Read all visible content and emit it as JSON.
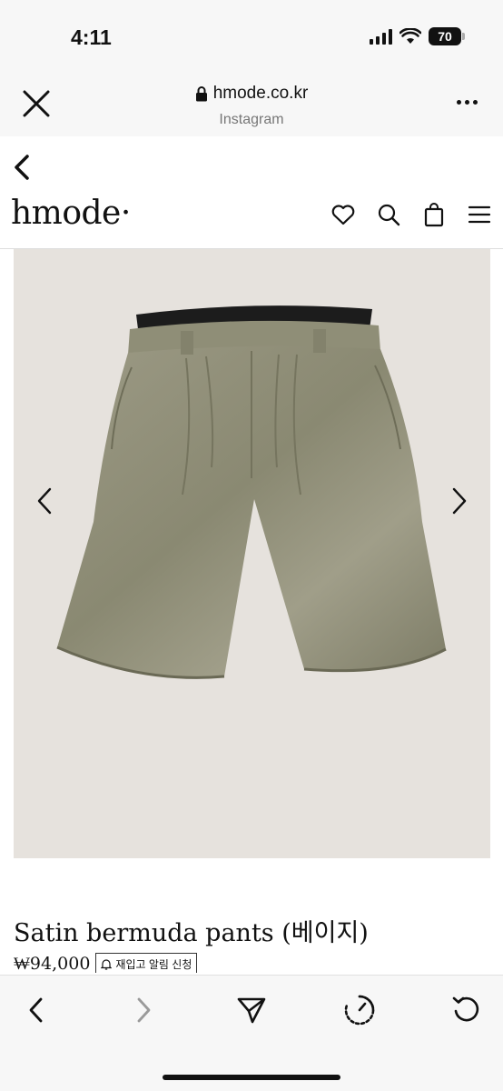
{
  "status_bar": {
    "time": "4:11",
    "battery": "70"
  },
  "browser": {
    "url": "hmode.co.kr",
    "source": "Instagram"
  },
  "site": {
    "logo": "hmode·"
  },
  "product": {
    "title": "Satin bermuda pants (베이지)",
    "price": "₩94,000",
    "restock_label": "재입고 알림 신청",
    "image_color": "#8d8c76"
  },
  "icons": {
    "close": "close-icon",
    "lock": "lock-icon",
    "more": "more-icon",
    "back": "back-icon",
    "heart": "heart-icon",
    "search": "search-icon",
    "bag": "bag-icon",
    "menu": "menu-icon",
    "bell": "bell-icon",
    "share": "share-icon",
    "speed": "speed-icon",
    "reload": "reload-icon"
  }
}
